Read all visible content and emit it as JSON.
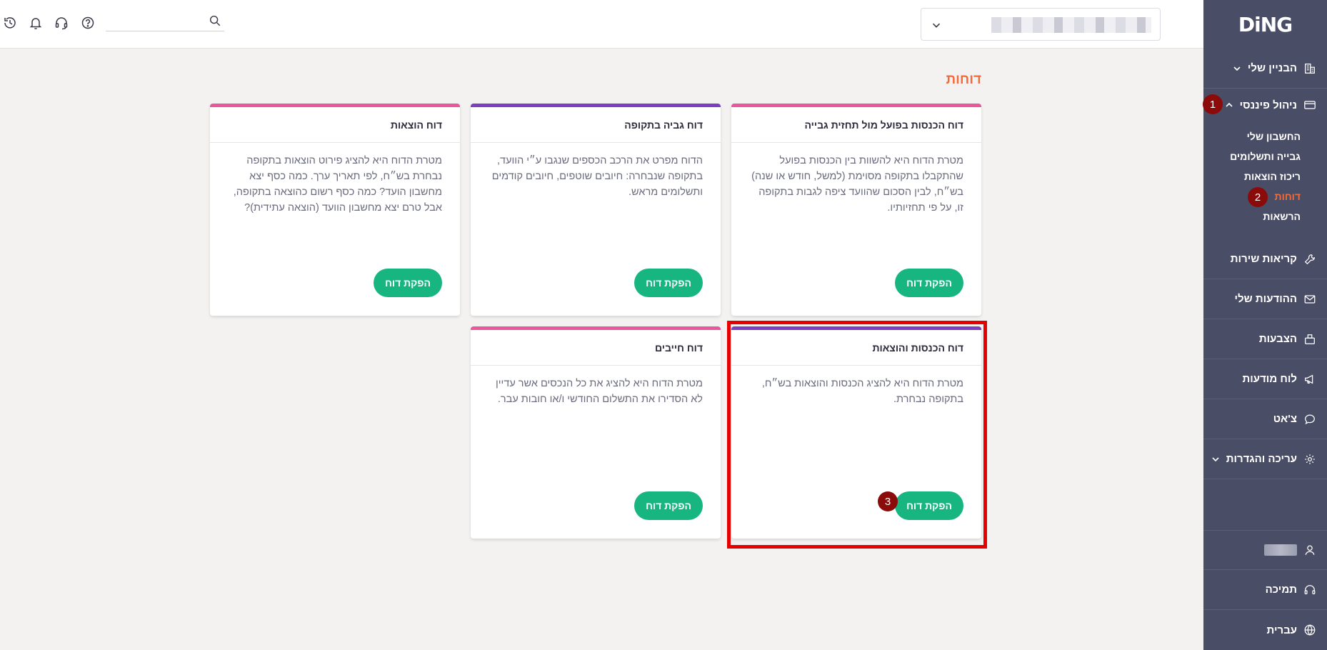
{
  "logo": "DiNG",
  "nav": {
    "building": "הבניין שלי",
    "finance": "ניהול פיננסי",
    "sub_items": [
      "החשבון שלי",
      "גבייה ותשלומים",
      "ריכוז הוצאות",
      "דוחות",
      "הרשאות"
    ],
    "service": "קריאות שירות",
    "messages": "ההודעות שלי",
    "votes": "הצבעות",
    "board": "לוח מודעות",
    "chat": "צ'אט",
    "settings": "עריכה והגדרות",
    "support": "תמיכה",
    "language": "עברית"
  },
  "badges": [
    "1",
    "2",
    "3"
  ],
  "page_title": "דוחות",
  "cards": [
    {
      "title": "דוח הכנסות בפועל מול תחזית גבייה",
      "text": "מטרת הדוח היא להשוות בין הכנסות בפועל שהתקבלו בתקופה מסוימת (למשל, חודש או שנה) בש״ח, לבין הסכום שהוועד ציפה לגבות בתקופה זו, על פי תחזיותיו.",
      "button": "הפקת דוח"
    },
    {
      "title": "דוח גביה בתקופה",
      "text": "הדוח מפרט את הרכב הכספים שנגבו ע״י הוועד, בתקופה שנבחרה: חיובים שוטפים, חיובים קודמים ותשלומים מראש.",
      "button": "הפקת דוח"
    },
    {
      "title": "דוח הוצאות",
      "text": "מטרת הדוח היא להציג פירוט הוצאות בתקופה נבחרת בש״ח, לפי תאריך ערך. כמה כסף יצא מחשבון הועד? כמה כסף רשום כהוצאה בתקופה, אבל טרם יצא מחשבון הוועד (הוצאה עתידית)?",
      "button": "הפקת דוח"
    },
    {
      "title": "דוח הכנסות והוצאות",
      "text": "מטרת הדוח היא להציג הכנסות והוצאות בש״ח, בתקופה נבחרת.",
      "button": "הפקת דוח"
    },
    {
      "title": "דוח חייבים",
      "text": "מטרת הדוח היא להציג את כל הנכסים אשר עדיין לא הסדירו את התשלום החודשי ו/או חובות עבר.",
      "button": "הפקת דוח"
    }
  ],
  "colors": {
    "accent": "#f26b3a",
    "button": "#17b57f",
    "sidebar": "#4a4d66",
    "highlight": "#e60000"
  }
}
